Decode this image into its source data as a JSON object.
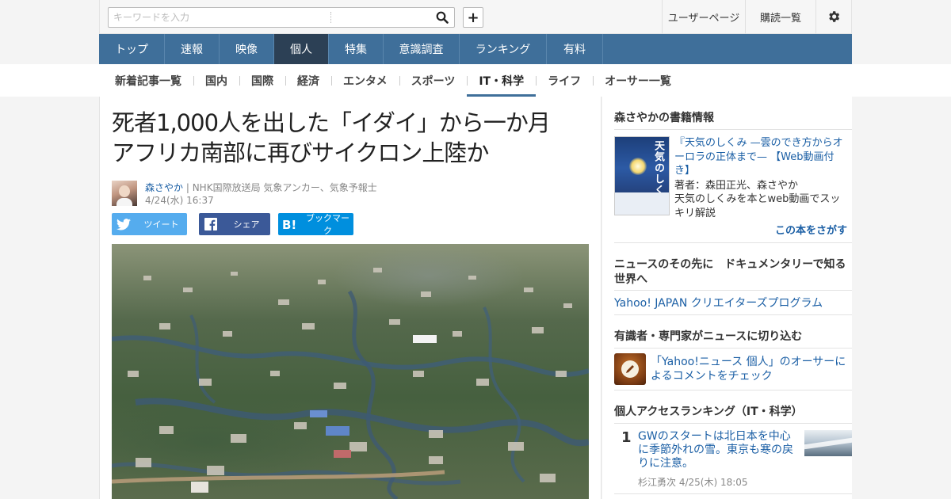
{
  "topbar": {
    "search_placeholder": "キーワードを入力",
    "plus_label": "+",
    "links": [
      "ユーザーページ",
      "購読一覧"
    ]
  },
  "mainnav": {
    "items": [
      "トップ",
      "速報",
      "映像",
      "個人",
      "特集",
      "意識調査",
      "ランキング",
      "有料"
    ],
    "active": "個人"
  },
  "subnav": {
    "items": [
      "新着記事一覧",
      "国内",
      "国際",
      "経済",
      "エンタメ",
      "スポーツ",
      "IT・科学",
      "ライフ",
      "オーサー一覧"
    ],
    "active": "IT・科学"
  },
  "article": {
    "title": "死者1,000人を出した「イダイ」から一か月　アフリカ南部に再びサイクロン上陸か",
    "author_name": "森さやか",
    "author_affiliation": "| NHK国際放送局 気象アンカー、気象予報士",
    "date": "4/24(水) 16:37",
    "share": {
      "tweet": "ツイート",
      "facebook": "シェア",
      "bookmark": "ブックマーク"
    }
  },
  "sidebar": {
    "book_section": {
      "heading": "森さやかの書籍情報",
      "cover_title": "天気のしくみ",
      "title": "『天気のしくみ —雲のでき方からオーロラの正体まで— 【Web動画付き】",
      "authors": "著者：森田正光、森さやか",
      "description": "天気のしくみを本とweb動画でスッキリ解説",
      "find_link": "この本をさがす"
    },
    "doc_section": {
      "heading": "ニュースのその先に　ドキュメンタリーで知る世界へ",
      "link": "Yahoo! JAPAN クリエイターズプログラム"
    },
    "expert_section": {
      "heading": "有識者・専門家がニュースに切り込む",
      "link": "「Yahoo!ニュース 個人」のオーサーによるコメントをチェック"
    },
    "ranking": {
      "heading": "個人アクセスランキング（IT・科学）",
      "items": [
        {
          "rank": "1",
          "title": "GWのスタートは北日本を中心に季節外れの雪。東京も寒の戻りに注意。",
          "meta": "杉江勇次  4/25(木) 18:05"
        }
      ]
    }
  },
  "colors": {
    "nav_blue": "#3f6f9a",
    "nav_active": "#2c4055",
    "link_blue": "#1b5fa5",
    "twitter": "#55acee",
    "facebook": "#3b5998",
    "hatena": "#008fde"
  }
}
